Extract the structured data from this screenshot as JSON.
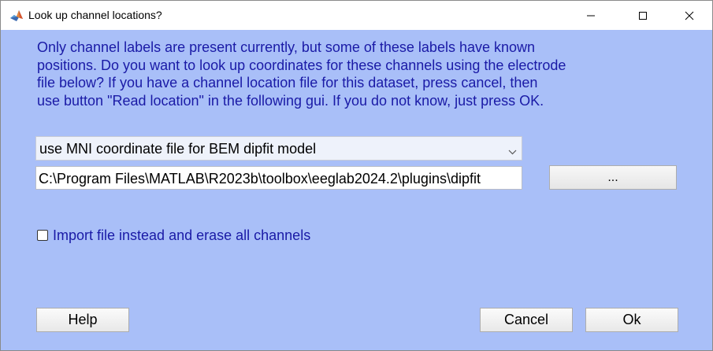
{
  "window": {
    "title": "Look up channel locations?",
    "icon": "matlab-icon",
    "controls": {
      "minimize_icon": "minimize-icon",
      "maximize_icon": "maximize-icon",
      "close_icon": "close-icon"
    }
  },
  "message": {
    "lines": [
      "Only channel labels are present currently, but some of these labels have known",
      "positions. Do you want to look up coordinates for these channels using the electrode",
      "file below? If you have a channel location file for this dataset, press cancel, then",
      "use button \"Read location\" in the following gui. If you do not know, just press OK."
    ]
  },
  "coordinate_select": {
    "selected": "use MNI coordinate file for BEM dipfit model",
    "icon": "chevron-down-icon"
  },
  "file_path": {
    "value": "C:\\Program Files\\MATLAB\\R2023b\\toolbox\\eeglab2024.2\\plugins\\dipfit"
  },
  "browse_button": {
    "label": "..."
  },
  "import_checkbox": {
    "label": "Import file instead and erase all channels",
    "checked": false
  },
  "buttons": {
    "help": "Help",
    "cancel": "Cancel",
    "ok": "Ok"
  },
  "colors": {
    "background": "#a9bff8",
    "text_accent": "#1a1aa6",
    "titlebar": "#ffffff"
  }
}
